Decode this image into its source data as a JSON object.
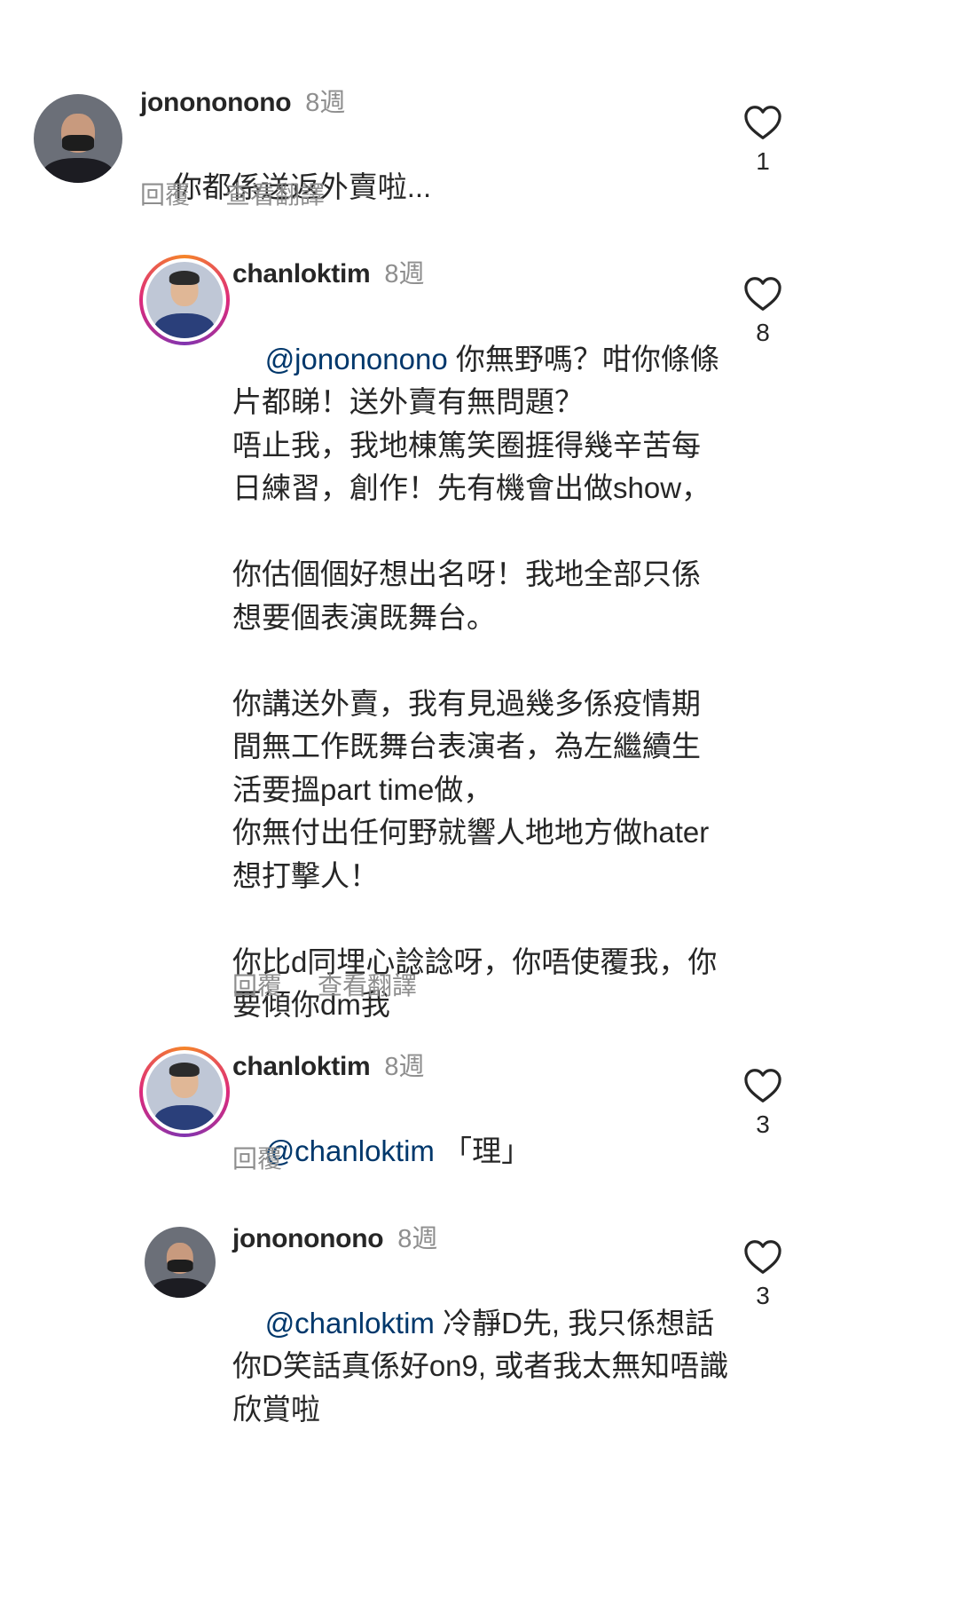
{
  "comments": [
    {
      "username": "jonononono",
      "time": "8週",
      "mention": "",
      "text": "你都係送返外賣啦...",
      "reply_label": "回覆",
      "translate_label": "查看翻譯",
      "likes": "1"
    },
    {
      "username": "chanloktim",
      "time": "8週",
      "mention": "@jonononono",
      "text": " 你無野嗎？咁你條條片都睇！送外賣有無問題？\n唔止我，我地棟篤笑圈捱得幾辛苦每日練習，創作！先有機會出做show，\n\n你估個個好想出名呀！我地全部只係想要個表演既舞台。\n\n你講送外賣，我有見過幾多係疫情期間無工作既舞台表演者，為左繼續生活要搵part time做，\n你無付出任何野就響人地地方做hater想打擊人！\n\n你比d同埋心諗諗呀，你唔使覆我，你要傾你dm我",
      "reply_label": "回覆",
      "translate_label": "查看翻譯",
      "likes": "8"
    },
    {
      "username": "chanloktim",
      "time": "8週",
      "mention": "@chanloktim",
      "text": " 「理」",
      "reply_label": "回覆",
      "translate_label": "",
      "likes": "3"
    },
    {
      "username": "jonononono",
      "time": "8週",
      "mention": "@chanloktim",
      "text": " 冷靜D先, 我只係想話你D笑話真係好on9, 或者我太無知唔識欣賞啦",
      "reply_label": "",
      "translate_label": "",
      "likes": "3"
    }
  ],
  "colors": {
    "mention": "#00376b",
    "muted": "#8e8e8e",
    "text": "#262626"
  },
  "icons": {
    "like": "heart-outline-icon"
  }
}
